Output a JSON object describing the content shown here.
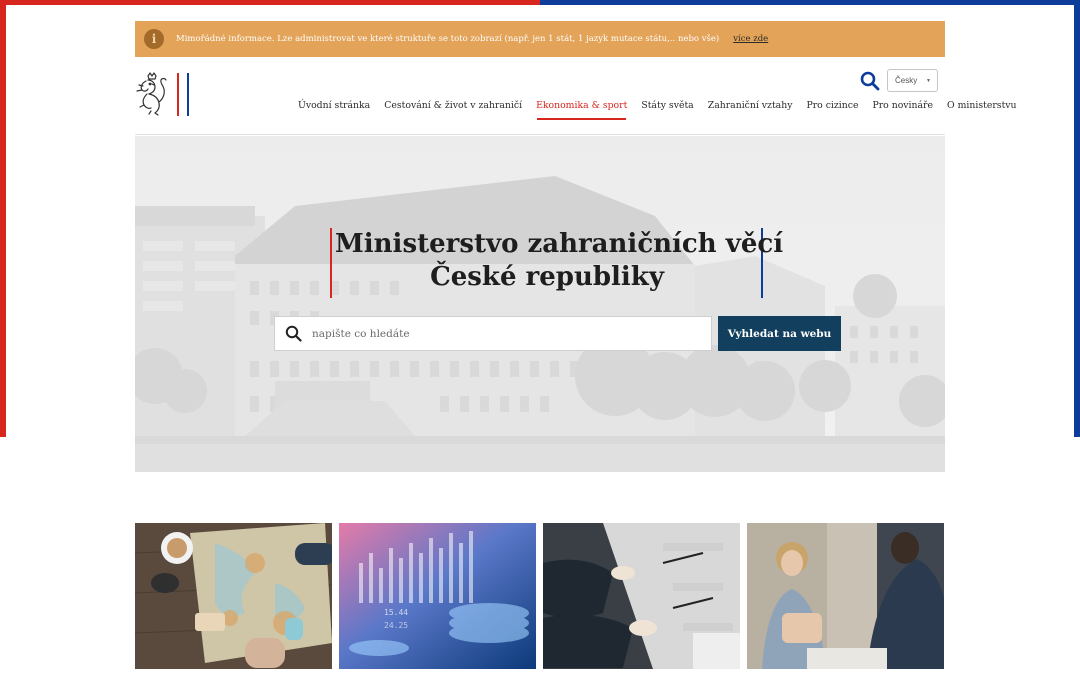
{
  "alert": {
    "icon": "info-icon",
    "text": "Mimořádné informace. Lze administrovat ve které struktuře se toto zobrazí (např. jen 1 stát, 1 jazyk mutace státu,.. nebo vše)",
    "link": "více zde",
    "color": "#e3a358"
  },
  "header": {
    "logo_icon": "lion-coat-of-arms-icon",
    "search_icon": "search-icon",
    "language": "Česky",
    "nav": [
      {
        "label": "Úvodní stránka",
        "active": false
      },
      {
        "label": "Cestování & život v zahraničí",
        "active": false
      },
      {
        "label": "Ekonomika & sport",
        "active": true
      },
      {
        "label": "Státy světa",
        "active": false
      },
      {
        "label": "Zahraniční vztahy",
        "active": false
      },
      {
        "label": "Pro cizince",
        "active": false
      },
      {
        "label": "Pro novináře",
        "active": false
      },
      {
        "label": "O ministerstvu",
        "active": false
      }
    ]
  },
  "hero": {
    "title_line1": "Ministerstvo zahraničních věcí",
    "title_line2": "České republiky",
    "search_placeholder": "napište co hledáte",
    "search_button": "Vyhledat na webu"
  },
  "tiles": [
    {
      "subject": "travel-map-photo"
    },
    {
      "subject": "finance-chart-photo"
    },
    {
      "subject": "conference-meeting-photo"
    },
    {
      "subject": "business-discussion-photo"
    }
  ],
  "colors": {
    "red": "#d7261e",
    "blue": "#0d3c9a",
    "button": "#123f5e",
    "active_nav": "#d7261e"
  }
}
